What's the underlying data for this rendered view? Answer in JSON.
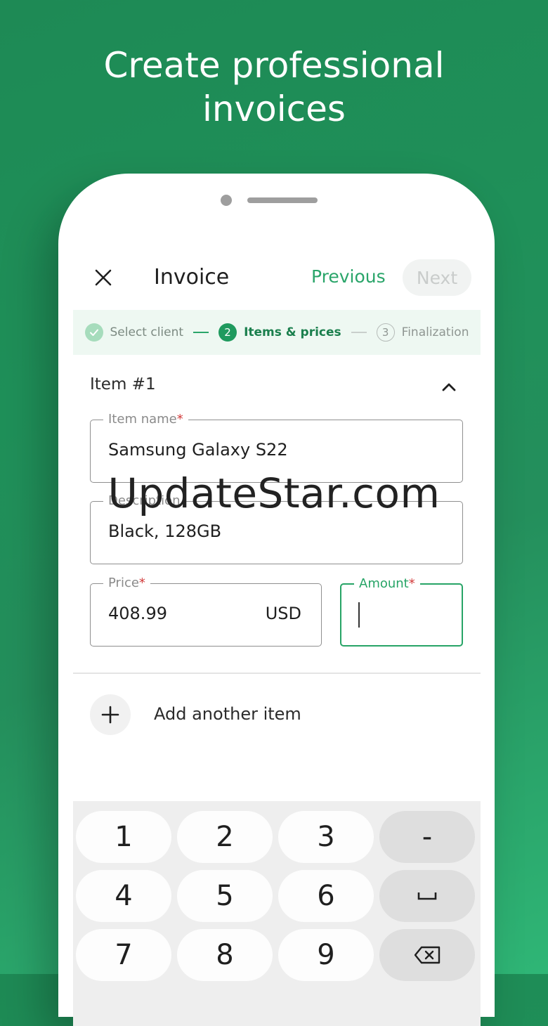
{
  "headline": {
    "line1": "Create professional",
    "line2": "invoices"
  },
  "appbar": {
    "title": "Invoice",
    "previous": "Previous",
    "next": "Next"
  },
  "stepper": {
    "steps": [
      {
        "number": "",
        "label": "Select client"
      },
      {
        "number": "2",
        "label": "Items & prices"
      },
      {
        "number": "3",
        "label": "Finalization"
      }
    ]
  },
  "item": {
    "header": "Item #1",
    "name": {
      "label": "Item name",
      "required": "*",
      "value": "Samsung Galaxy S22"
    },
    "description": {
      "label": "Description",
      "value": "Black, 128GB"
    },
    "price": {
      "label": "Price",
      "required": "*",
      "value": "408.99",
      "currency": "USD"
    },
    "amount": {
      "label": "Amount",
      "required": "*",
      "value": ""
    }
  },
  "add_item": {
    "label": "Add another item"
  },
  "keypad": {
    "keys": [
      "1",
      "2",
      "3",
      "-",
      "4",
      "5",
      "6",
      "␣",
      "7",
      "8",
      "9",
      "⌫"
    ]
  },
  "watermark": "UpdateStar.com",
  "colors": {
    "accent": "#27a466",
    "background": "#1f9059",
    "active_step": "#1f9a5e"
  }
}
